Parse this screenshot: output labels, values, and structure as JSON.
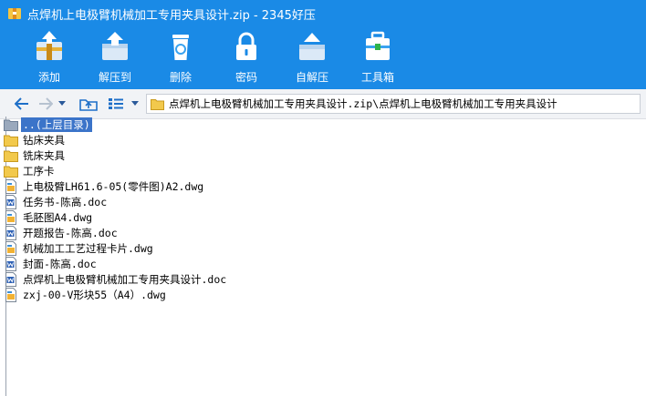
{
  "window": {
    "title": "点焊机上电极臂机械加工专用夹具设计.zip - 2345好压"
  },
  "toolbar": {
    "items": [
      {
        "label": "添加",
        "icon": "add-archive-icon"
      },
      {
        "label": "解压到",
        "icon": "extract-icon"
      },
      {
        "label": "删除",
        "icon": "trash-icon"
      },
      {
        "label": "密码",
        "icon": "lock-icon"
      },
      {
        "label": "自解压",
        "icon": "self-extract-icon"
      },
      {
        "label": "工具箱",
        "icon": "toolbox-icon"
      }
    ]
  },
  "address": {
    "path": "点焊机上电极臂机械加工专用夹具设计.zip\\点焊机上电极臂机械加工专用夹具设计"
  },
  "files": [
    {
      "name": "..(上层目录)",
      "type": "parent",
      "selected": true
    },
    {
      "name": "钻床夹具",
      "type": "folder"
    },
    {
      "name": "铣床夹具",
      "type": "folder"
    },
    {
      "name": "工序卡",
      "type": "folder"
    },
    {
      "name": "上电极臂LH61.6-05(零件图)A2.dwg",
      "type": "dwg"
    },
    {
      "name": "任务书-陈高.doc",
      "type": "doc"
    },
    {
      "name": "毛胚图A4.dwg",
      "type": "dwg"
    },
    {
      "name": "开题报告-陈高.doc",
      "type": "doc"
    },
    {
      "name": "机械加工工艺过程卡片.dwg",
      "type": "dwg"
    },
    {
      "name": "封面-陈高.doc",
      "type": "doc"
    },
    {
      "name": "点焊机上电极臂机械加工专用夹具设计.doc",
      "type": "doc"
    },
    {
      "name": "zxj-00-V形块55（A4）.dwg",
      "type": "dwg"
    }
  ],
  "colors": {
    "titlebar": "#1a8ae6",
    "selection": "#3b74c9",
    "folder": "#f2c94c"
  }
}
